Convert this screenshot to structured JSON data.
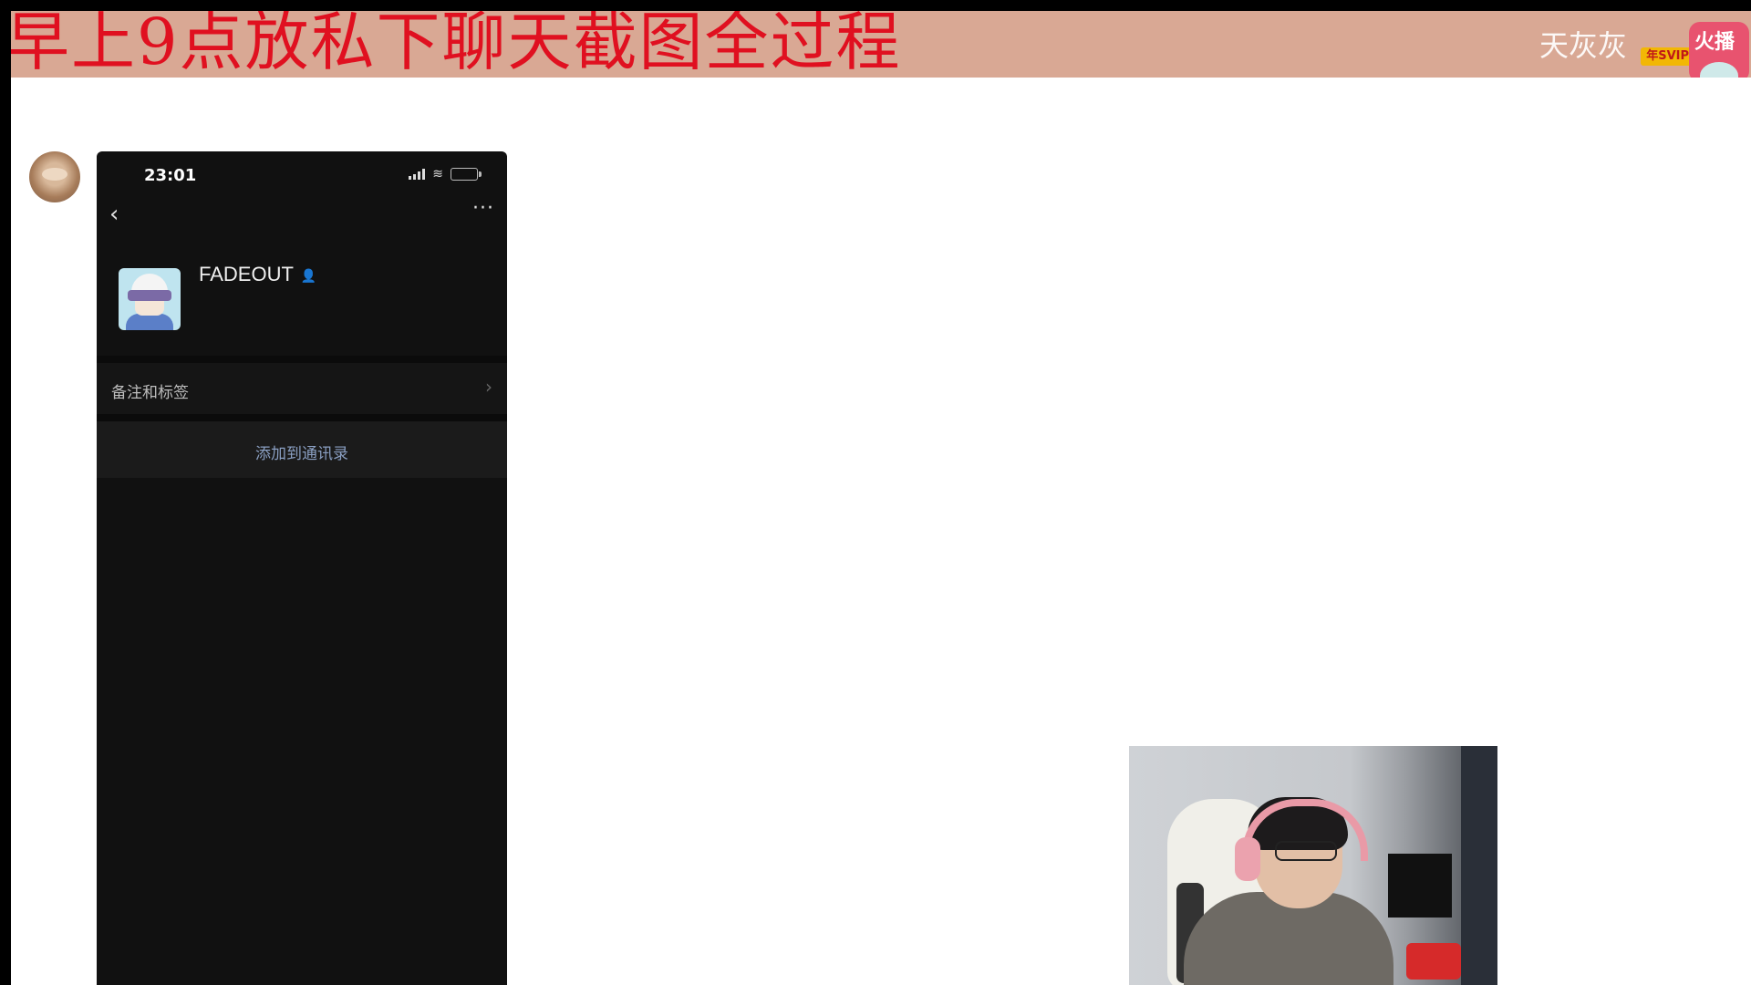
{
  "banner": {
    "title": "早上9点放私下聊天截图全过程",
    "streamer_name": "天灰灰",
    "vip_badge": "年SVIP",
    "platform_logo_text": "火播"
  },
  "phone": {
    "status_time": "23:01",
    "back_icon": "‹",
    "more_icon": "···",
    "profile_name": "FADEOUT",
    "remarks_label": "备注和标签",
    "remarks_chevron": "›",
    "add_contact_label": "添加到通讯录"
  },
  "icons": {
    "sender_avatar": "avatar",
    "verified": "person-icon",
    "signal": "signal-icon",
    "wifi": "wifi-icon",
    "battery": "battery-icon"
  },
  "colors": {
    "banner_bg": "#d9a894",
    "banner_title": "#e01020",
    "phone_bg": "#111111",
    "link_blue": "#8a9fc2"
  }
}
